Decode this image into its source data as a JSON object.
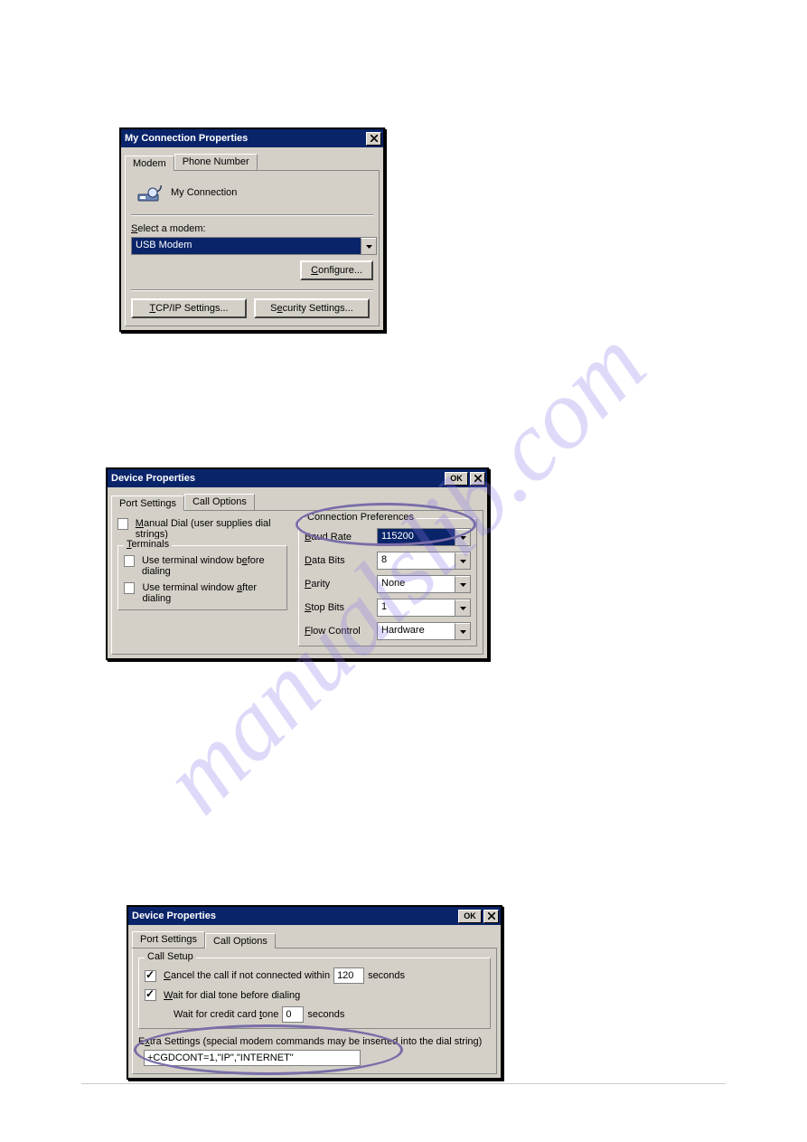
{
  "watermark": "manualslib.com",
  "win1": {
    "title": "My Connection Properties",
    "tabs": [
      "Modem",
      "Phone Number"
    ],
    "connection_name": "My Connection",
    "select_modem_label": "Select a modem:",
    "modem_selected": "USB Modem",
    "configure_button": "Configure...",
    "tcpip_button": "TCP/IP Settings...",
    "security_button": "Security Settings..."
  },
  "win2": {
    "title": "Device Properties",
    "ok": "OK",
    "tabs": [
      "Port Settings",
      "Call Options"
    ],
    "manual_dial": "Manual Dial (user supplies dial strings)",
    "terminals_legend": "Terminals",
    "term_before": "Use terminal window before dialing",
    "term_after": "Use terminal window after dialing",
    "prefs_legend": "Connection Preferences",
    "baud_label": "Baud Rate",
    "baud_value": "115200",
    "databits_label": "Data Bits",
    "databits_value": "8",
    "parity_label": "Parity",
    "parity_value": "None",
    "stop_label": "Stop Bits",
    "stop_value": "1",
    "flow_label": "Flow Control",
    "flow_value": "Hardware"
  },
  "win3": {
    "title": "Device Properties",
    "ok": "OK",
    "tabs": [
      "Port Settings",
      "Call Options"
    ],
    "setup_legend": "Call Setup",
    "cancel_call_label": "Cancel the call if not connected within",
    "cancel_seconds_value": "120",
    "seconds": "seconds",
    "wait_dialtone": "Wait for dial tone before dialing",
    "credit_label": "Wait for credit card tone",
    "credit_value": "0",
    "extra_label": "Extra Settings (special modem commands may be inserted into the dial string)",
    "extra_value": "+CGDCONT=1,\"IP\",\"INTERNET\""
  }
}
